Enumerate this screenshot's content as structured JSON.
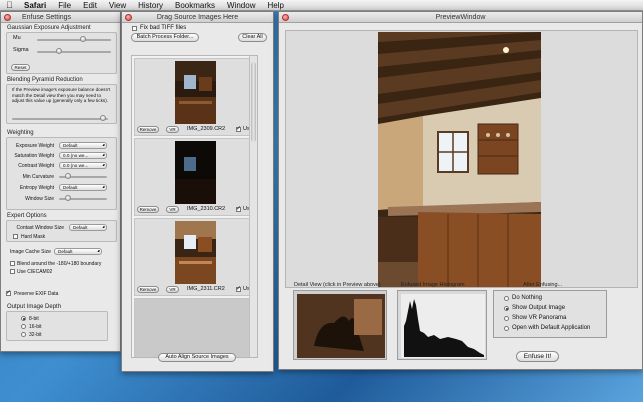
{
  "menubar": {
    "apple": "",
    "items": [
      "Safari",
      "File",
      "Edit",
      "View",
      "History",
      "Bookmarks",
      "Window",
      "Help"
    ]
  },
  "settings": {
    "title": "Enfuse Settings",
    "gaussian": {
      "label": "Gaussian Exposure Adjustment",
      "mu": "Mu",
      "sigma": "Sigma",
      "reset": "Reset",
      "mu_level": 0.62,
      "sigma_level": 0.3
    },
    "blending": {
      "label": "Blending Pyramid Reduction",
      "help": "If the Preview image's exposure balance doesn't match the Detail view then you may need to adjust this value up (generally only a few ticks).",
      "level": 0.95
    },
    "weighting": {
      "label": "Weighting",
      "rows": [
        {
          "label": "Exposure Weight",
          "value": "Default"
        },
        {
          "label": "Saturation Weight",
          "value": "0.0 (no we..."
        },
        {
          "label": "Contrast Weight",
          "value": "0.0 (no we..."
        }
      ],
      "min_curvature": "Min Curvature",
      "entropy": {
        "label": "Entropy Weight",
        "value": "Default"
      },
      "window_size": "Window Size"
    },
    "expert": {
      "label": "Expert Options",
      "contrast_window": {
        "label": "Contast Window Size",
        "value": "Default"
      },
      "hard_mask": "Hard Mask"
    },
    "image_cache": {
      "label": "Image Cache Size",
      "value": "Default"
    },
    "blend_boundary": "Blend around the -180/+180 boundary",
    "use_ciecam": "Use CIECAM02",
    "preserve_exif": "Preserve EXIF Data",
    "depth": {
      "label": "Output Image Depth",
      "options": [
        "8-bit",
        "16-bit",
        "32-bit"
      ],
      "selected": 0
    }
  },
  "drag": {
    "title": "Drag Source Images Here",
    "fix_tiff": "Fix bad TIFF files",
    "batch": "Batch Process Folder...",
    "clear": "Clear All",
    "remove": "Remove",
    "vr": "VR",
    "use": "Use",
    "images": [
      "IMG_2309.CR2",
      "IMG_2310.CR2",
      "IMG_2311.CR2"
    ],
    "align": "Auto Align Source Images"
  },
  "preview": {
    "title": "PreviewWindow",
    "detail_label": "Detail View (click in Preview above)",
    "histogram_label": "Enfused Image Histogram",
    "after_label": "After Enfusing...",
    "options": [
      "Do Nothing",
      "Show Output Image",
      "Show VR Panorama",
      "Open with Default Application"
    ],
    "selected": 1,
    "enfuse_button": "Enfuse It!"
  },
  "colors": {
    "desktop": "#2d6fae",
    "window_bg": "#e9e9e9",
    "close_red": "#d9413a"
  }
}
